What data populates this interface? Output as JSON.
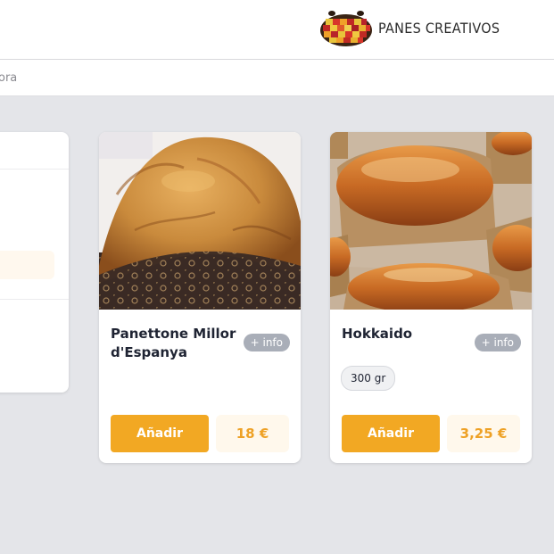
{
  "header": {
    "brand": "PANES CREATIVOS",
    "logo_icon": "bread-mosaic-logo"
  },
  "subnav": {
    "partial_text": "ora"
  },
  "products": [
    {
      "name": "Panettone Millor d'Espanya",
      "info_label": "+ info",
      "add_label": "Añadir",
      "price": "18 €",
      "image": "panettone-photo"
    },
    {
      "name": "Hokkaido",
      "info_label": "+ info",
      "weight": "300 gr",
      "add_label": "Añadir",
      "price": "3,25 €",
      "image": "hokkaido-bread-photo"
    }
  ],
  "colors": {
    "accent": "#f2a823",
    "price_text": "#eea125",
    "background": "#e4e5e9"
  }
}
